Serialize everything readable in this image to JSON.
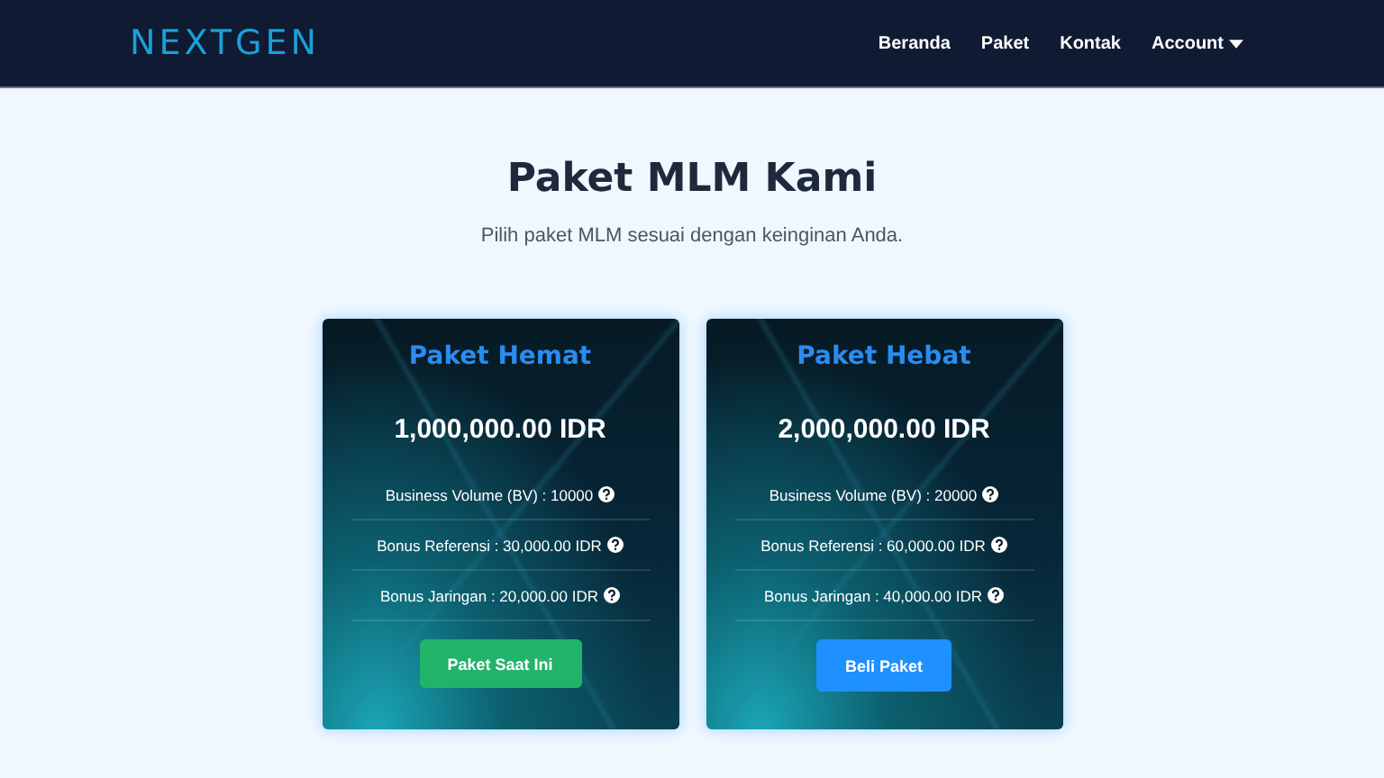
{
  "navbar": {
    "logo": "NEXTGEN",
    "links": [
      {
        "label": "Beranda",
        "dropdown": false
      },
      {
        "label": "Paket",
        "dropdown": false
      },
      {
        "label": "Kontak",
        "dropdown": false
      },
      {
        "label": "Account",
        "dropdown": true
      }
    ]
  },
  "heading": "Paket MLM Kami",
  "subtitle": "Pilih paket MLM sesuai dengan keinginan Anda.",
  "packages": [
    {
      "name": "Paket Hemat",
      "price": "1,000,000.00 IDR",
      "features": [
        "Business Volume (BV) : 10000",
        "Bonus Referensi : 30,000.00 IDR",
        "Bonus Jaringan : 20,000.00 IDR"
      ],
      "button": {
        "label": "Paket Saat Ini",
        "kind": "current"
      }
    },
    {
      "name": "Paket Hebat",
      "price": "2,000,000.00 IDR",
      "features": [
        "Business Volume (BV) : 20000",
        "Bonus Referensi : 60,000.00 IDR",
        "Bonus Jaringan : 40,000.00 IDR"
      ],
      "button": {
        "label": "Beli Paket",
        "kind": "buy"
      }
    }
  ]
}
